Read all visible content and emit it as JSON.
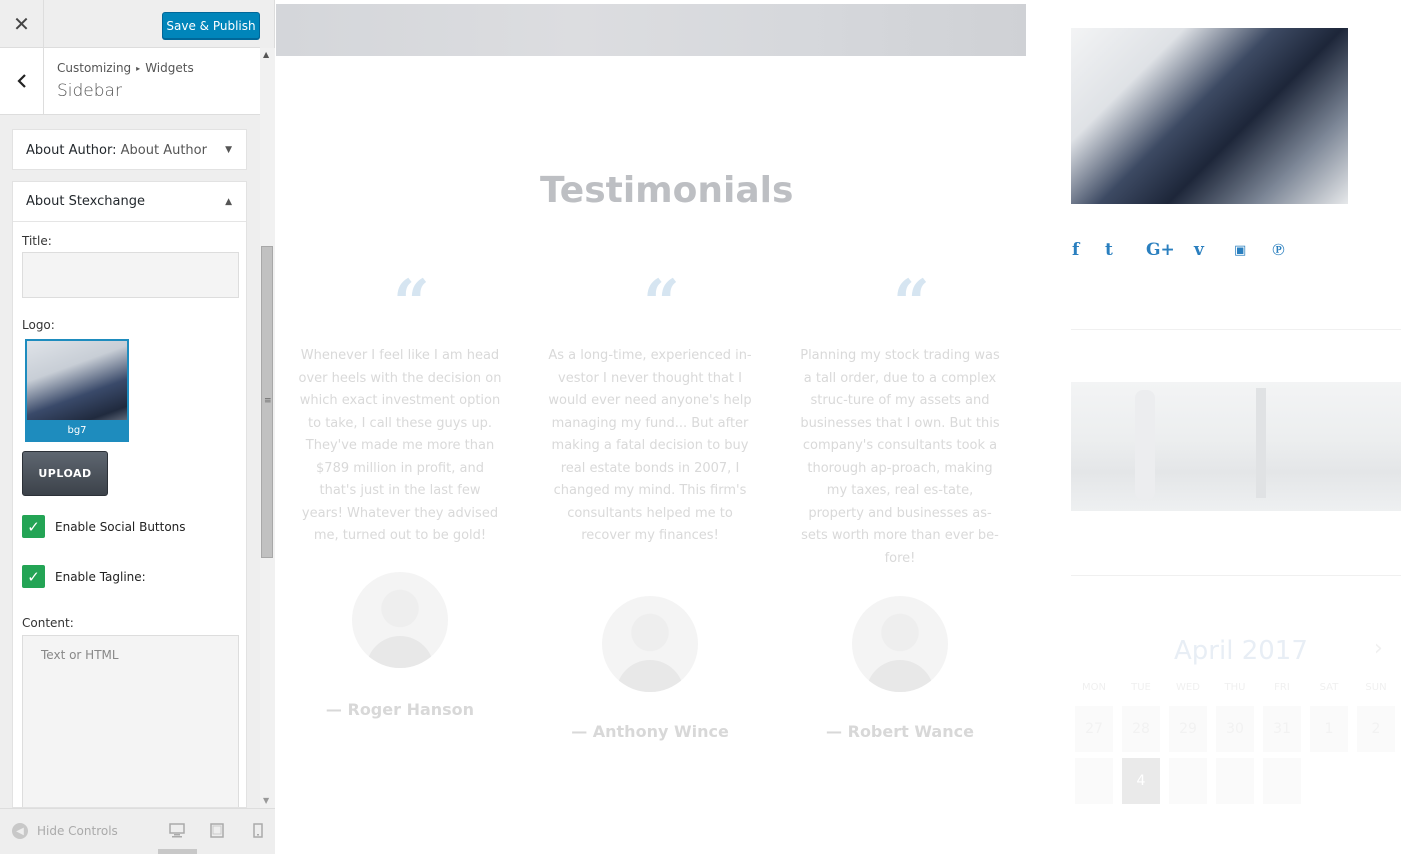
{
  "customizer": {
    "close_icon": "✕",
    "publish_label": "Save & Publish",
    "breadcrumb": {
      "part1": "Customizing",
      "separator": "▸",
      "part2": "Widgets"
    },
    "section_title": "Sidebar",
    "widgets": [
      {
        "label_bold": "About Author:",
        "label_rest": " About Author",
        "state": "collapsed"
      },
      {
        "label": "About Stexchange",
        "state": "expanded"
      }
    ],
    "form": {
      "title_label": "Title:",
      "title_value": "",
      "logo_label": "Logo:",
      "logo_caption": "bg7",
      "upload_label": "UPLOAD",
      "social_label": "Enable Social Buttons",
      "social_checked": true,
      "tagline_label": "Enable Tagline:",
      "tagline_checked": true,
      "content_label": "Content:",
      "content_placeholder": "Text or HTML"
    },
    "footer": {
      "hide_controls_label": "Hide Controls"
    }
  },
  "preview": {
    "testimonials_title": "Testimonials",
    "testimonials": [
      {
        "text": "Whenever I feel like I am head over heels with the decision on which exact investment option to take, I call these guys up. They've made me more than $789 million in profit, and that's just in the last few years! Whatever they advised me, turned out to be gold!",
        "name": "— Roger Hanson"
      },
      {
        "text": "As a long-time, experienced in-vestor I never thought that I would ever need anyone's help managing my fund... But after making a fatal decision to buy real estate bonds in 2007, I changed my mind. This firm's consultants helped me to recover my finances!",
        "name": "— Anthony Wince"
      },
      {
        "text": "Planning my stock trading was a tall order, due to a complex struc-ture of my assets and businesses that I own. But this company's consultants took a thorough ap-proach, making my taxes, real es-tate, property and businesses as-sets worth more than ever be-fore!",
        "name": "— Robert Wance"
      }
    ],
    "social_icons": [
      "facebook-icon",
      "twitter-icon",
      "google-plus-icon",
      "vimeo-icon",
      "youtube-icon",
      "pinterest-icon"
    ],
    "calendar": {
      "title": "April 2017",
      "days": [
        "MON",
        "TUE",
        "WED",
        "THU",
        "FRI",
        "SAT",
        "SUN"
      ],
      "row1": [
        "27",
        "28",
        "29",
        "30",
        "31",
        "1",
        "2"
      ],
      "today": "4"
    },
    "colors": {
      "accent": "#0085ba",
      "social": "#2a7fbf",
      "check": "#23a455"
    }
  }
}
